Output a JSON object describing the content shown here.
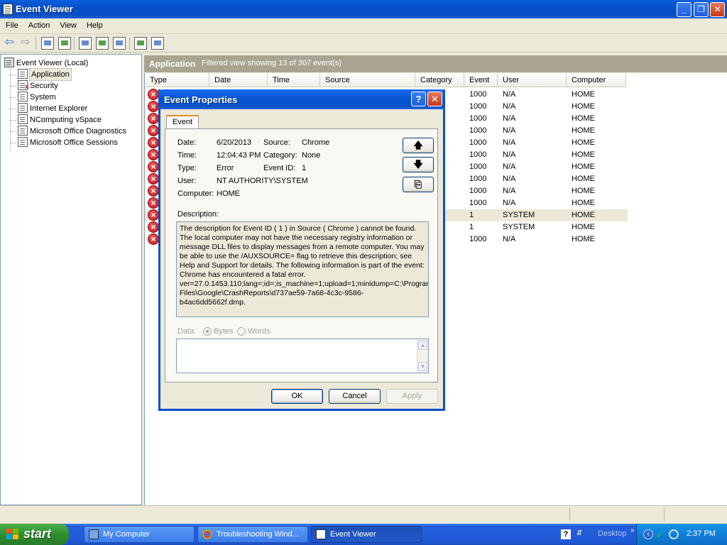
{
  "window": {
    "title": "Event Viewer"
  },
  "menu": [
    "File",
    "Action",
    "View",
    "Help"
  ],
  "tree": {
    "root": "Event Viewer (Local)",
    "items": [
      "Application",
      "Security",
      "System",
      "Internet Explorer",
      "NComputing vSpace",
      "Microsoft Office Diagnostics",
      "Microsoft Office Sessions"
    ]
  },
  "pane": {
    "name": "Application",
    "filter": "Filtered view showing 13 of 307 event(s)"
  },
  "columns": [
    "Type",
    "Date",
    "Time",
    "Source",
    "Category",
    "Event",
    "User",
    "Computer"
  ],
  "rows": [
    {
      "event": "1000",
      "user": "N/A",
      "computer": "HOME"
    },
    {
      "event": "1000",
      "user": "N/A",
      "computer": "HOME"
    },
    {
      "event": "1000",
      "user": "N/A",
      "computer": "HOME"
    },
    {
      "event": "1000",
      "user": "N/A",
      "computer": "HOME"
    },
    {
      "event": "1000",
      "user": "N/A",
      "computer": "HOME"
    },
    {
      "event": "1000",
      "user": "N/A",
      "computer": "HOME"
    },
    {
      "event": "1000",
      "user": "N/A",
      "computer": "HOME"
    },
    {
      "event": "1000",
      "user": "N/A",
      "computer": "HOME"
    },
    {
      "event": "1000",
      "user": "N/A",
      "computer": "HOME"
    },
    {
      "event": "1000",
      "user": "N/A",
      "computer": "HOME"
    },
    {
      "event": "1",
      "user": "SYSTEM",
      "computer": "HOME"
    },
    {
      "event": "1",
      "user": "SYSTEM",
      "computer": "HOME"
    },
    {
      "event": "1000",
      "user": "N/A",
      "computer": "HOME"
    }
  ],
  "dialog": {
    "title": "Event Properties",
    "tab": "Event",
    "labels": {
      "date": "Date:",
      "time": "Time:",
      "type": "Type:",
      "user": "User:",
      "computer": "Computer:",
      "source": "Source:",
      "category": "Category:",
      "event_id": "Event ID:",
      "description": "Description:",
      "data": "Data:",
      "bytes": "Bytes",
      "words": "Words"
    },
    "values": {
      "date": "6/20/2013",
      "time": "12:04:43 PM",
      "type": "Error",
      "user": "NT AUTHORITY\\SYSTEM",
      "computer": "HOME",
      "source": "Chrome",
      "category": "None",
      "event_id": "1"
    },
    "description": "The description for Event ID ( 1 ) in Source ( Chrome ) cannot be found. The local computer may not have the necessary registry information or message DLL files to display messages from a remote computer. You may be able to use the /AUXSOURCE= flag to retrieve this description; see Help and Support for details. The following information is part of the event: Chrome has encountered a fatal error.\nver=27.0.1453.110;lang=;id=;is_machine=1;upload=1;minidump=C:\\Program Files\\Google\\CrashReports\\d737ae59-7a68-4c3c-9586-b4ac6dd5662f.dmp.",
    "buttons": {
      "ok": "OK",
      "cancel": "Cancel",
      "apply": "Apply"
    }
  },
  "taskbar": {
    "start": "start",
    "tasks": [
      "My Computer",
      "Troubleshooting Wind...",
      "Event Viewer"
    ],
    "desktop": "Desktop",
    "clock": "2:37 PM"
  }
}
